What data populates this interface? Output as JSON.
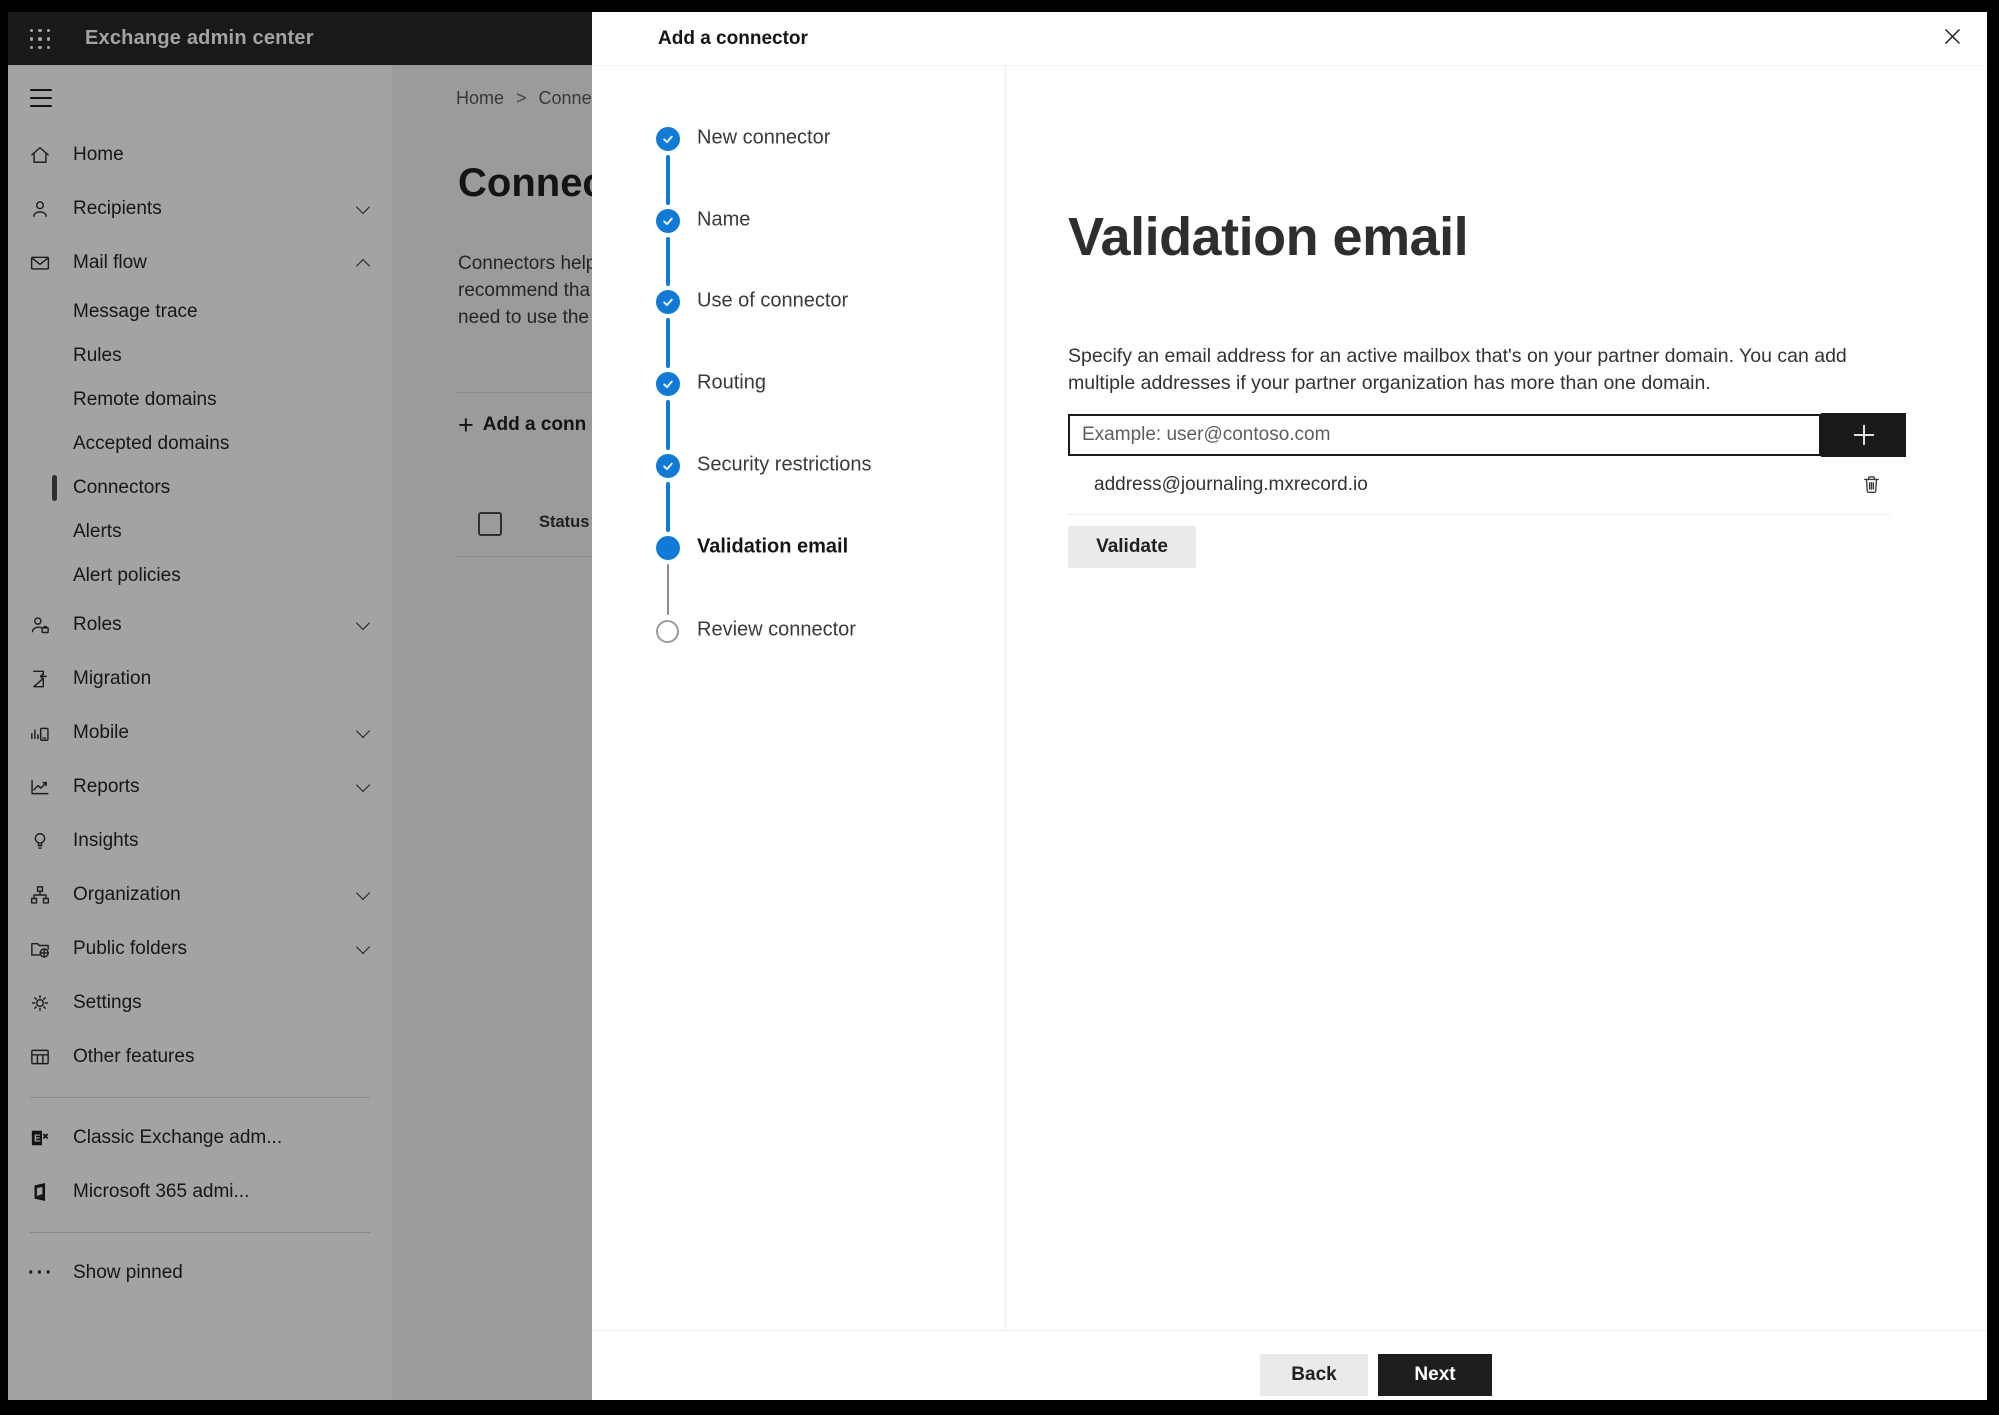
{
  "app": {
    "title": "Exchange admin center"
  },
  "sidebar": {
    "items": [
      {
        "label": "Home",
        "icon": "home-icon",
        "chevron": "none",
        "level": 1
      },
      {
        "label": "Recipients",
        "icon": "people-icon",
        "chevron": "down",
        "level": 1
      },
      {
        "label": "Mail flow",
        "icon": "mail-icon",
        "chevron": "up",
        "level": 1
      },
      {
        "label": "Message trace",
        "level": 2
      },
      {
        "label": "Rules",
        "level": 2
      },
      {
        "label": "Remote domains",
        "level": 2
      },
      {
        "label": "Accepted domains",
        "level": 2
      },
      {
        "label": "Connectors",
        "level": 2,
        "selected": true
      },
      {
        "label": "Alerts",
        "level": 2
      },
      {
        "label": "Alert policies",
        "level": 2
      },
      {
        "label": "Roles",
        "icon": "roles-icon",
        "chevron": "down",
        "level": 1
      },
      {
        "label": "Migration",
        "icon": "migration-icon",
        "chevron": "none",
        "level": 1
      },
      {
        "label": "Mobile",
        "icon": "mobile-icon",
        "chevron": "down",
        "level": 1
      },
      {
        "label": "Reports",
        "icon": "reports-icon",
        "chevron": "down",
        "level": 1
      },
      {
        "label": "Insights",
        "icon": "insights-icon",
        "chevron": "none",
        "level": 1
      },
      {
        "label": "Organization",
        "icon": "organization-icon",
        "chevron": "down",
        "level": 1
      },
      {
        "label": "Public folders",
        "icon": "public-folders-icon",
        "chevron": "down",
        "level": 1
      },
      {
        "label": "Settings",
        "icon": "settings-icon",
        "chevron": "none",
        "level": 1
      },
      {
        "label": "Other features",
        "icon": "other-features-icon",
        "chevron": "none",
        "level": 1
      }
    ],
    "footer_items": [
      {
        "label": "Classic Exchange adm...",
        "icon": "classic-exchange-icon"
      },
      {
        "label": "Microsoft 365 admi...",
        "icon": "microsoft-365-icon"
      }
    ],
    "show_pinned_label": "Show pinned"
  },
  "background_page": {
    "breadcrumb": {
      "home": "Home",
      "separator": ">",
      "current": "Conne"
    },
    "title": "Connec",
    "description_lines": [
      "Connectors help",
      "recommend tha",
      "need to use the"
    ],
    "add_button_label": "Add a conn",
    "add_button_plus": "+",
    "table": {
      "status_header": "Status"
    }
  },
  "modal": {
    "title": "Add a connector",
    "steps": [
      {
        "label": "New connector",
        "state": "completed"
      },
      {
        "label": "Name",
        "state": "completed"
      },
      {
        "label": "Use of connector",
        "state": "completed"
      },
      {
        "label": "Routing",
        "state": "completed"
      },
      {
        "label": "Security restrictions",
        "state": "completed"
      },
      {
        "label": "Validation email",
        "state": "current"
      },
      {
        "label": "Review connector",
        "state": "upcoming"
      }
    ],
    "content": {
      "heading": "Validation email",
      "description": "Specify an email address for an active mailbox that's on your partner domain. You can add multiple addresses if your partner organization has more than one domain.",
      "email_input": {
        "value": "",
        "placeholder": "Example: user@contoso.com"
      },
      "addresses": [
        {
          "email": "address@journaling.mxrecord.io"
        }
      ],
      "validate_button": "Validate"
    },
    "footer": {
      "back_label": "Back",
      "next_label": "Next"
    }
  },
  "colors": {
    "accent_blue": "#0f7bd7",
    "dark_button": "#1b1a19",
    "header_bg": "#282828",
    "overlay": "rgba(0,0,0,0.36)"
  }
}
